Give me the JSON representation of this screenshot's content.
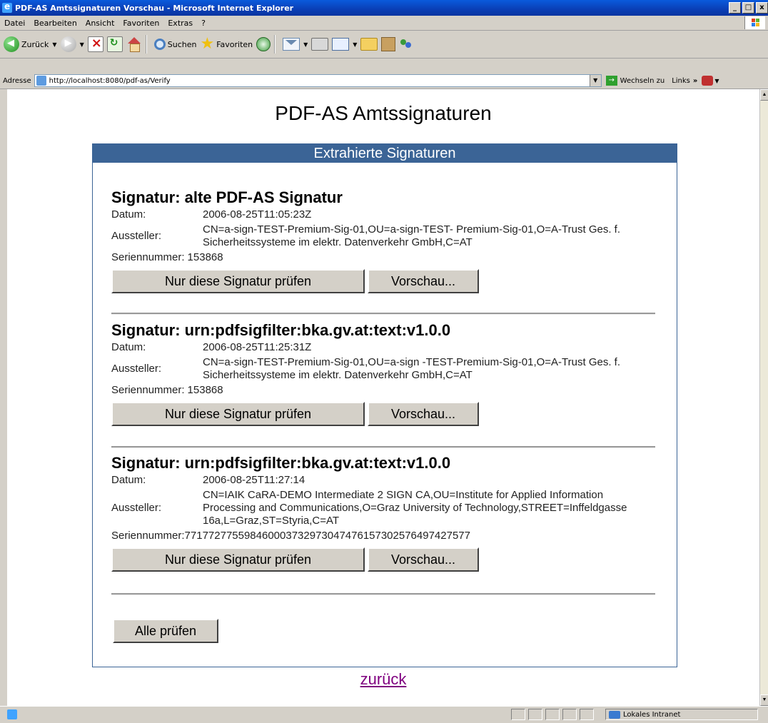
{
  "window": {
    "title": "PDF-AS Amtssignaturen Vorschau - Microsoft Internet Explorer",
    "buttons": {
      "min": "_",
      "max": "□",
      "close": "x"
    }
  },
  "menubar": {
    "items": [
      "Datei",
      "Bearbeiten",
      "Ansicht",
      "Favoriten",
      "Extras",
      "?"
    ]
  },
  "toolbar": {
    "back_label": "Zurück",
    "search_label": "Suchen",
    "favorites_label": "Favoriten"
  },
  "addressbar": {
    "label": "Adresse",
    "url": "http://localhost:8080/pdf-as/Verify",
    "go_label": "Wechseln zu",
    "links_label": "Links",
    "links_more": "»"
  },
  "page": {
    "title": "PDF-AS Amtssignaturen",
    "box_title": "Extrahierte Signaturen",
    "field_labels": {
      "date": "Datum:",
      "issuer": "Aussteller:",
      "serial": "Seriennummer:"
    },
    "check_button": "Nur diese Signatur prüfen",
    "preview_button": "Vorschau...",
    "check_all_button": "Alle prüfen",
    "back_link": "zurück",
    "signatures": [
      {
        "heading": "Signatur: alte PDF-AS Signatur",
        "date": "2006-08-25T11:05:23Z",
        "issuer": "CN=a-sign-TEST-Premium-Sig-01,OU=a-sign-TEST- Premium-Sig-01,O=A-Trust Ges. f. Sicherheitssysteme im elektr. Datenverkehr GmbH,C=AT",
        "serial": "153868"
      },
      {
        "heading": "Signatur: urn:pdfsigfilter:bka.gv.at:text:v1.0.0",
        "date": "2006-08-25T11:25:31Z",
        "issuer": "CN=a-sign-TEST-Premium-Sig-01,OU=a-sign -TEST-Premium-Sig-01,O=A-Trust Ges. f. Sicherheitssysteme im elektr. Datenverkehr GmbH,C=AT",
        "serial": "153868"
      },
      {
        "heading": "Signatur: urn:pdfsigfilter:bka.gv.at:text:v1.0.0",
        "date": "2006-08-25T11:27:14",
        "issuer": "CN=IAIK CaRA-DEMO Intermediate 2 SIGN CA,OU=Institute for Applied Information Processing and Communications,O=Graz University of Technology,STREET=Inffeldgasse 16a,L=Graz,ST=Styria,C=AT",
        "serial": "771772775598460003732973047476157302576497427577"
      }
    ]
  },
  "statusbar": {
    "zone": "Lokales Intranet"
  },
  "colors": {
    "header_blue": "#3b6496",
    "link_visited": "#800080",
    "chrome": "#d4d0c8"
  }
}
